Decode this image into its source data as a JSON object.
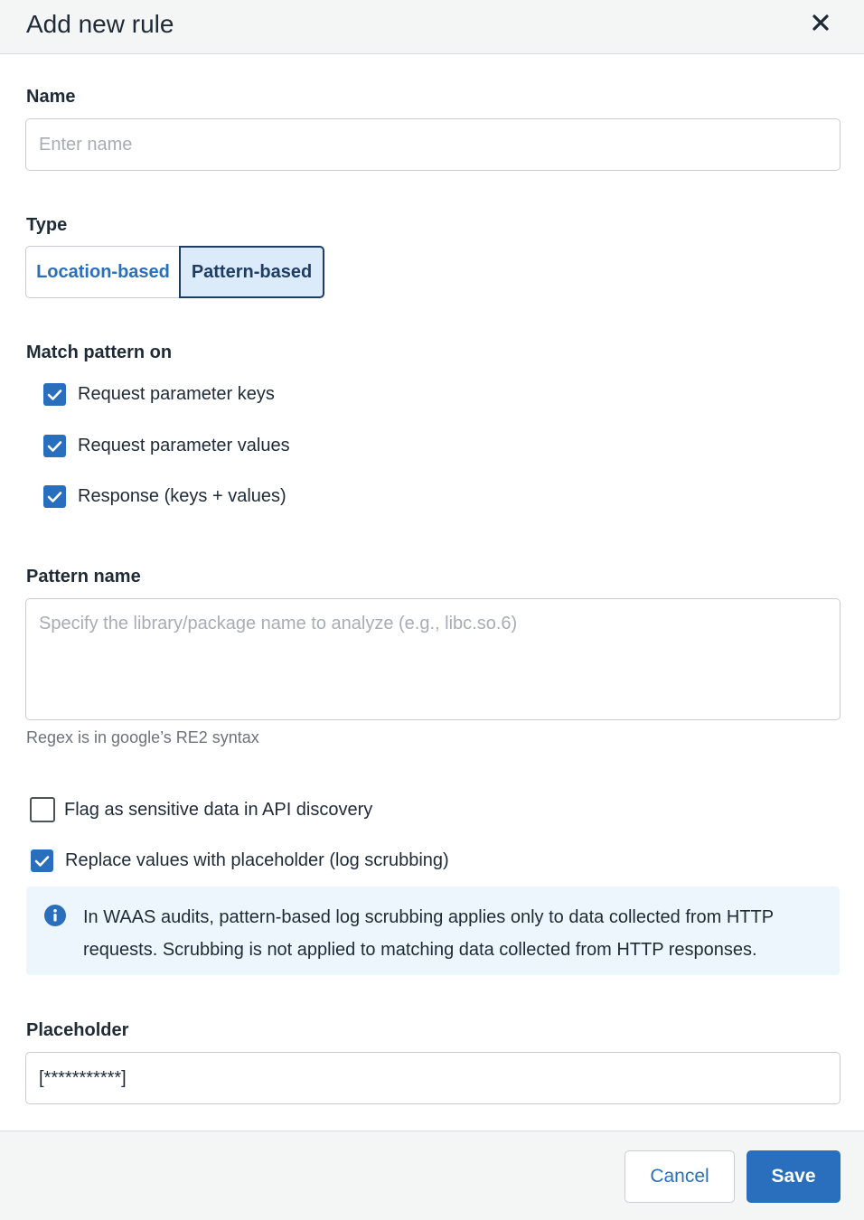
{
  "dialog": {
    "title": "Add new rule",
    "close_icon": "close-icon"
  },
  "name": {
    "label": "Name",
    "value": "",
    "placeholder": "Enter name"
  },
  "type": {
    "label": "Type",
    "options": [
      {
        "label": "Location-based",
        "selected": false
      },
      {
        "label": "Pattern-based",
        "selected": true
      }
    ]
  },
  "match": {
    "label": "Match pattern on",
    "options": [
      {
        "label": "Request parameter keys",
        "checked": true
      },
      {
        "label": "Request parameter values",
        "checked": true
      },
      {
        "label": "Response (keys + values)",
        "checked": true
      }
    ]
  },
  "pattern": {
    "label": "Pattern name",
    "value": "",
    "placeholder": "Specify the library/package name to analyze (e.g., libc.so.6)",
    "hint": "Regex is in google’s RE2 syntax"
  },
  "flags": [
    {
      "label": "Flag as sensitive data in API discovery",
      "checked": false
    },
    {
      "label": "Replace values with placeholder (log scrubbing)",
      "checked": true
    }
  ],
  "info": {
    "icon": "info-icon",
    "text": "In WAAS audits, pattern-based log scrubbing applies only to data collected from HTTP requests. Scrubbing is not applied to matching data collected from HTTP responses."
  },
  "placeholder": {
    "label": "Placeholder",
    "value": "[***********]"
  },
  "footer": {
    "cancel_label": "Cancel",
    "save_label": "Save"
  },
  "colors": {
    "accent": "#2a6fbd",
    "selected_bg": "#dcebfa",
    "info_bg": "#eef6fd",
    "header_bg": "#f4f5f5"
  }
}
